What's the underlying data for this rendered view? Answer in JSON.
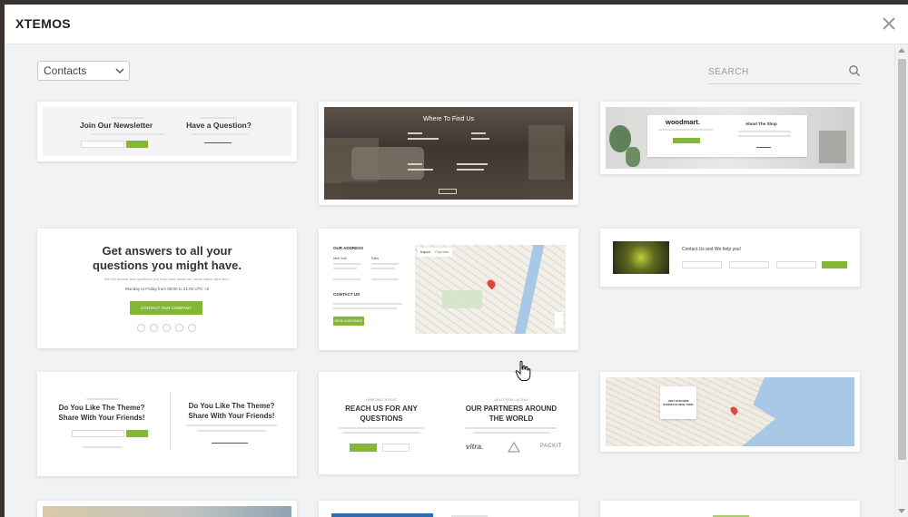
{
  "window": {
    "brand": "XTEMOS"
  },
  "toolbar": {
    "category": "Contacts",
    "search_placeholder": "SEARCH"
  },
  "cards": {
    "newsletter": {
      "left_title": "Join Our Newsletter",
      "right_title": "Have a Question?"
    },
    "find_us": {
      "title": "Where To Find Us"
    },
    "shop": {
      "logo": "woodmart.",
      "title": "About The Shop"
    },
    "answers": {
      "title_line1": "Get answers to all your",
      "title_line2": "questions you might have.",
      "subtitle": "We will answer any questions you may have about our online sales right here.",
      "hours": "Monday to Friday from 09:00 to 21:00 UTC +2",
      "button": "CONTACT OUR COMPANY"
    },
    "address": {
      "heading": "OUR ADDRESS",
      "city1": "New York",
      "city2": "Paris",
      "contact_heading": "CONTACT US",
      "button": "SEND A MESSAGE",
      "map_tab1": "Карта",
      "map_tab2": "Спутник"
    },
    "help": {
      "title": "Contact Us and We help you!"
    },
    "share": {
      "left_title_line1": "Do You Like The Theme?",
      "left_title_line2": "Share With Your Friends!",
      "right_title_line1": "Do You Like The Theme?",
      "right_title_line2": "Share With Your Friends!"
    },
    "partners": {
      "left_sub": "HABITANT A FEAT",
      "left_title_line1": "REACH US FOR ANY",
      "left_title_line2": "QUESTIONS",
      "right_sub": "VELIT SEM LACINIA",
      "right_title_line1": "OUR PARTNERS AROUND",
      "right_title_line2": "THE WORLD",
      "logo1": "vitra.",
      "logo3": "PACKIT"
    },
    "stores": {
      "title_line1": "VISIT OUR NEW",
      "title_line2": "STORES IN NEW YORK"
    }
  },
  "colors": {
    "accent": "#83b735",
    "overlay": "#f1f2f4"
  }
}
